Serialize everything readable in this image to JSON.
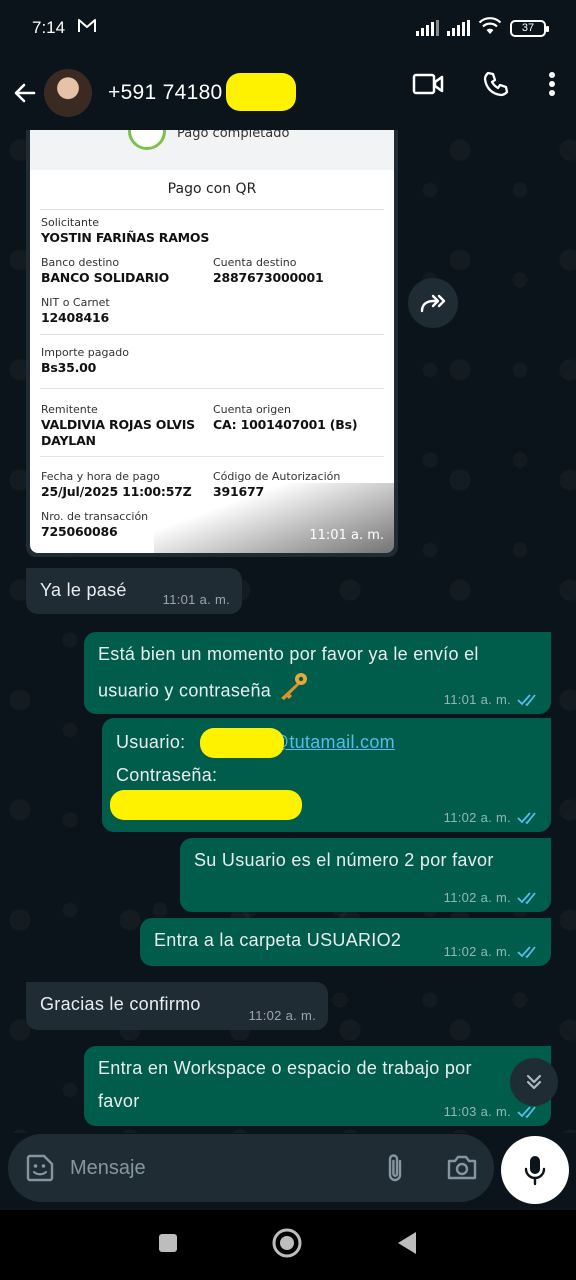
{
  "status": {
    "time": "7:14",
    "battery": "37"
  },
  "header": {
    "contact": "+591 74180"
  },
  "receipt": {
    "status": "Pago completado",
    "title": "Pago con QR",
    "solicitante_label": "Solicitante",
    "solicitante": "YOSTIN FARIÑAS RAMOS",
    "banco_label": "Banco destino",
    "banco": "BANCO SOLIDARIO",
    "cuenta_dest_label": "Cuenta destino",
    "cuenta_dest": "2887673000001",
    "nit_label": "NIT o Carnet",
    "nit": "12408416",
    "importe_label": "Importe pagado",
    "importe": "Bs35.00",
    "remitente_label": "Remitente",
    "remitente_1": "VALDIVIA ROJAS OLVIS",
    "remitente_2": "DAYLAN",
    "cuenta_orig_label": "Cuenta origen",
    "cuenta_orig": "CA: 1001407001 (Bs)",
    "fecha_label": "Fecha y hora de pago",
    "fecha": "25/Jul/2025 11:00:57Z",
    "codigo_label": "Código de Autorización",
    "codigo": "391677",
    "nro_label": "Nro. de transacción",
    "nro": "725060086",
    "time": "11:01 a. m."
  },
  "messages": [
    {
      "dir": "in",
      "line1": "Ya le pasé",
      "time": "11:01 a. m."
    },
    {
      "dir": "out",
      "line1": "Está bien un momento por favor ya le envío el",
      "line2": "usuario y contraseña",
      "time": "11:01 a. m."
    },
    {
      "dir": "out",
      "line1_label": "Usuario:",
      "line1_domain": "@tutamail.com",
      "line2": "Contraseña:",
      "time": "11:02 a. m."
    },
    {
      "dir": "out",
      "line1": "Su Usuario es el número 2 por favor",
      "time": "11:02 a. m."
    },
    {
      "dir": "out",
      "line1": "Entra a la carpeta USUARIO2",
      "time": "11:02 a. m."
    },
    {
      "dir": "in",
      "line1": "Gracias le confirmo",
      "time": "11:02 a. m."
    },
    {
      "dir": "out",
      "line1": "Entra en Workspace o espacio de trabajo por",
      "line2": "favor",
      "time": "11:03 a. m."
    }
  ],
  "composer": {
    "placeholder": "Mensaje"
  },
  "colors": {
    "incoming": "#202c33",
    "outgoing": "#005c4b",
    "read_ticks": "#53bdeb",
    "redaction": "#fff200"
  }
}
